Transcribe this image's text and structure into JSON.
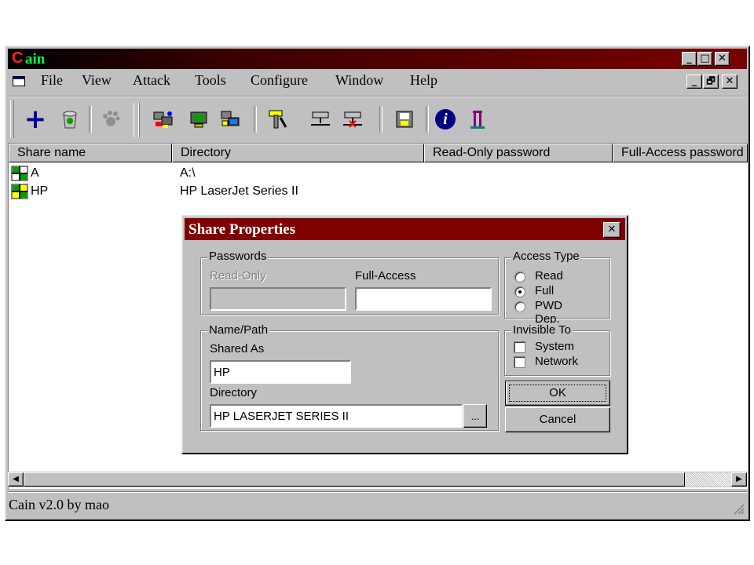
{
  "window": {
    "title_first": "C",
    "title_rest": "ain",
    "menu": [
      {
        "label": "File"
      },
      {
        "label": "View"
      },
      {
        "label": "Attack"
      },
      {
        "label": "Tools"
      },
      {
        "label": "Configure"
      },
      {
        "label": "Window"
      },
      {
        "label": "Help"
      }
    ],
    "min_glyph": "_",
    "max_glyph": "□",
    "close_glyph": "✕",
    "restore_glyph": "🗗"
  },
  "toolbar": {
    "add_glyph": "+",
    "info_glyph": "i"
  },
  "table": {
    "columns": [
      "Share name",
      "Directory",
      "Read-Only password",
      "Full-Access password"
    ],
    "rows": [
      {
        "name": "A",
        "directory": "A:\\"
      },
      {
        "name": "HP",
        "directory": "HP LaserJet Series II"
      }
    ]
  },
  "status": {
    "text": "Cain v2.0 by mao"
  },
  "dialog": {
    "title": "Share Properties",
    "close_glyph": "✕",
    "passwords_group": "Passwords",
    "read_only_label": "Read-Only",
    "full_access_label": "Full-Access",
    "read_only_value": "",
    "full_access_value": "",
    "access_type_group": "Access Type",
    "access_options": [
      "Read",
      "Full",
      "PWD Dep."
    ],
    "access_selected": "Full",
    "name_path_group": "Name/Path",
    "shared_as_label": "Shared As",
    "shared_as_value": "HP",
    "directory_label": "Directory",
    "directory_value": "HP LASERJET SERIES II",
    "browse_label": "...",
    "invisible_to_group": "Invisible To",
    "invisible_options": [
      "System",
      "Network"
    ],
    "ok_label": "OK",
    "cancel_label": "Cancel"
  }
}
